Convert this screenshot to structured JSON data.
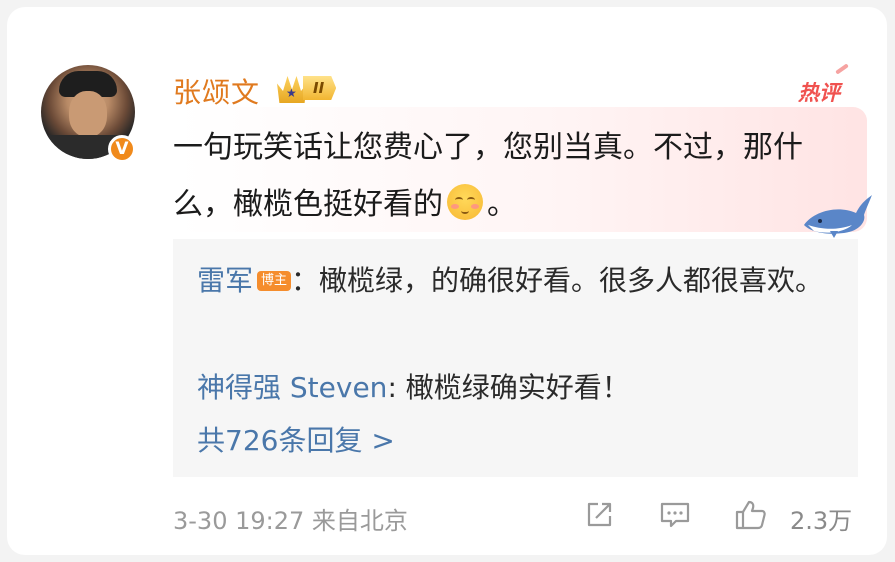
{
  "comment": {
    "username": "张颂文",
    "level_badge": "II",
    "hot_label": "热评",
    "text_part1": "一句玩笑话让您费心了，您别当真。不过，那什么，橄榄色挺好看的",
    "text_part2": "。",
    "emoji_icon": "shy-smile-emoji",
    "verified_badge": "V",
    "accent_color": "#e07a1f"
  },
  "replies": [
    {
      "name": "雷军",
      "badge": "博主",
      "separator": "：",
      "text": "橄榄绿，的确很好看。很多人都很喜欢。"
    },
    {
      "name": "神得强 Steven",
      "separator": ": ",
      "text": "橄榄绿确实好看！"
    }
  ],
  "more_replies": "共726条回复 >",
  "meta": {
    "timestamp": "3-30 19:27",
    "source": "来自北京"
  },
  "actions": {
    "share_icon": "share-icon",
    "comment_icon": "comment-icon",
    "like_icon": "thumbs-up-icon",
    "like_count": "2.3万"
  },
  "colors": {
    "link": "#4a77aa",
    "hot": "#f0524f",
    "meta": "#9a9a9a"
  }
}
